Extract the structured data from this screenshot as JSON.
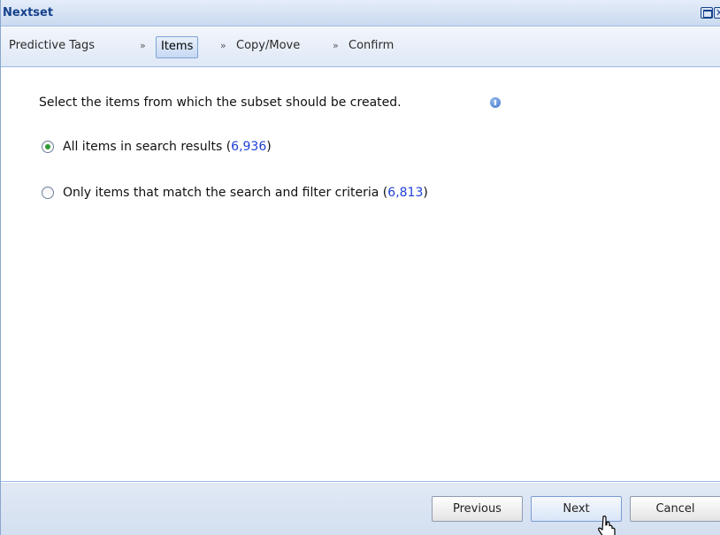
{
  "window": {
    "title": "Nextset"
  },
  "breadcrumb": {
    "steps": [
      "Predictive Tags",
      "Items",
      "Copy/Move",
      "Confirm"
    ],
    "separator": "»",
    "active_index": 1
  },
  "content": {
    "prompt": "Select the items from which the subset should be created.",
    "options": [
      {
        "label": "All items in search results (",
        "count": "6,936",
        "suffix": ")",
        "selected": true
      },
      {
        "label": "Only items that match the search and filter criteria (",
        "count": "6,813",
        "suffix": ")",
        "selected": false
      }
    ]
  },
  "footer": {
    "previous_label": "Previous",
    "next_label": "Next",
    "cancel_label": "Cancel"
  },
  "colors": {
    "title_text": "#15428b",
    "link_count": "#1e3fd6",
    "radio_selected": "#2f9a33",
    "panel_border": "#99bbe8"
  },
  "icons": [
    "maximize-icon",
    "close-icon",
    "info-icon",
    "hand-cursor-icon"
  ]
}
